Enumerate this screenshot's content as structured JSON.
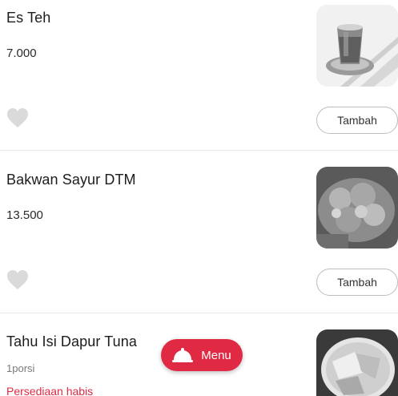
{
  "items": [
    {
      "name": "Es Teh",
      "price": "7.000",
      "add_label": "Tambah",
      "image_icon": "iced-tea-photo"
    },
    {
      "name": "Bakwan Sayur DTM",
      "price": "13.500",
      "add_label": "Tambah",
      "image_icon": "vegetable-fritter-photo"
    },
    {
      "name": "Tahu Isi Dapur Tuna",
      "note": "1porsi",
      "status": "Persediaan habis",
      "image_icon": "stuffed-tofu-photo"
    }
  ],
  "menu_button": {
    "label": "Menu",
    "icon": "cloche-icon"
  },
  "colors": {
    "accent": "#e02a43",
    "heart": "#dadada",
    "divider": "#e9e9e9"
  }
}
